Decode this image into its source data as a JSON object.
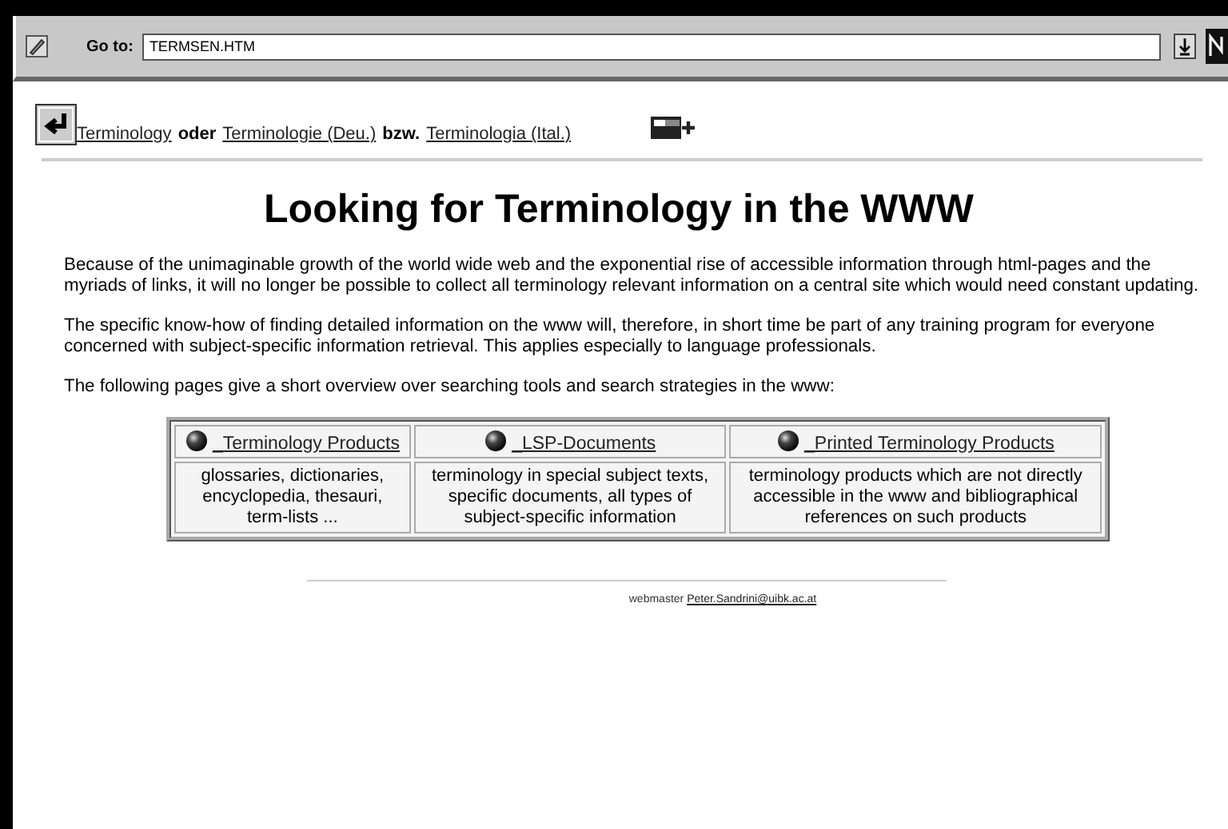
{
  "toolbar": {
    "goto_label": "Go to:",
    "url": "TERMSEN.HTM"
  },
  "language_links": [
    {
      "kind": "link",
      "text": "Terminology"
    },
    {
      "kind": "word",
      "text": "oder"
    },
    {
      "kind": "link",
      "text": "Terminologie (Deu.)"
    },
    {
      "kind": "word",
      "text": "bzw."
    },
    {
      "kind": "link",
      "text": "Terminologia (Ital.)"
    }
  ],
  "heading": "Looking for Terminology in the WWW",
  "paragraphs": [
    "Because of the unimaginable growth of the world wide web and the exponential rise of accessible information through html-pages and the myriads of links, it will no longer be possible to collect all terminology relevant information on a central site which would need constant updating.",
    "The specific know-how of finding detailed information on the www will, therefore, in short time be part of any training program for everyone concerned with subject-specific information retrieval. This applies especially to language professionals.",
    "The following pages give a short overview over searching tools and search strategies in the www:"
  ],
  "table": {
    "columns": [
      {
        "link": "_Terminology Products",
        "description": "glossaries, dictionaries, encyclopedia, thesauri, term-lists ..."
      },
      {
        "link": "_LSP-Documents",
        "description": "terminology in special subject texts, specific documents, all types of subject-specific information"
      },
      {
        "link": "_Printed Terminology Products",
        "description": "terminology products which are not directly accessible in the www and bibliographical references on such products"
      }
    ]
  },
  "footer": {
    "label": "webmaster",
    "email": "Peter.Sandrini@uibk.ac.at"
  }
}
